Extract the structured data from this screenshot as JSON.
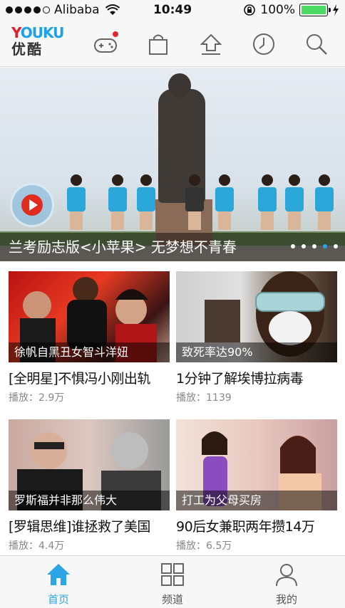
{
  "status_bar": {
    "carrier": "Alibaba",
    "time": "10:49",
    "battery_percent": "100%",
    "battery_level": 1.0
  },
  "header": {
    "logo_en": "YOUKU",
    "logo_cn": "优酷",
    "icons": [
      "game-controller-icon",
      "shopping-bag-icon",
      "upload-icon",
      "history-clock-icon",
      "search-icon"
    ]
  },
  "banner": {
    "caption": "兰考励志版<小苹果> 无梦想不青春",
    "page_count": 5,
    "active_page": 4
  },
  "videos": [
    {
      "overlay": "徐帆自黑丑女智斗洋妞",
      "title": "[全明星]不惧冯小刚出轨",
      "plays": "播放：2.9万"
    },
    {
      "overlay": "致死率达90%",
      "title": "1分钟了解埃博拉病毒",
      "plays": "播放：1139"
    },
    {
      "overlay": "罗斯福并非那么伟大",
      "title": "[罗辑思维]谁拯救了美国",
      "plays": "播放：4.4万"
    },
    {
      "overlay": "打工为父母买房",
      "title": "90后女兼职两年攒14万",
      "plays": "播放：6.5万"
    }
  ],
  "tabs": [
    {
      "label": "首页",
      "icon": "home-icon",
      "active": true
    },
    {
      "label": "频道",
      "icon": "grid-icon",
      "active": false
    },
    {
      "label": "我的",
      "icon": "user-icon",
      "active": false
    }
  ],
  "colors": {
    "accent": "#2ba5e6",
    "badge": "#e3262c",
    "battery": "#4cd964"
  }
}
